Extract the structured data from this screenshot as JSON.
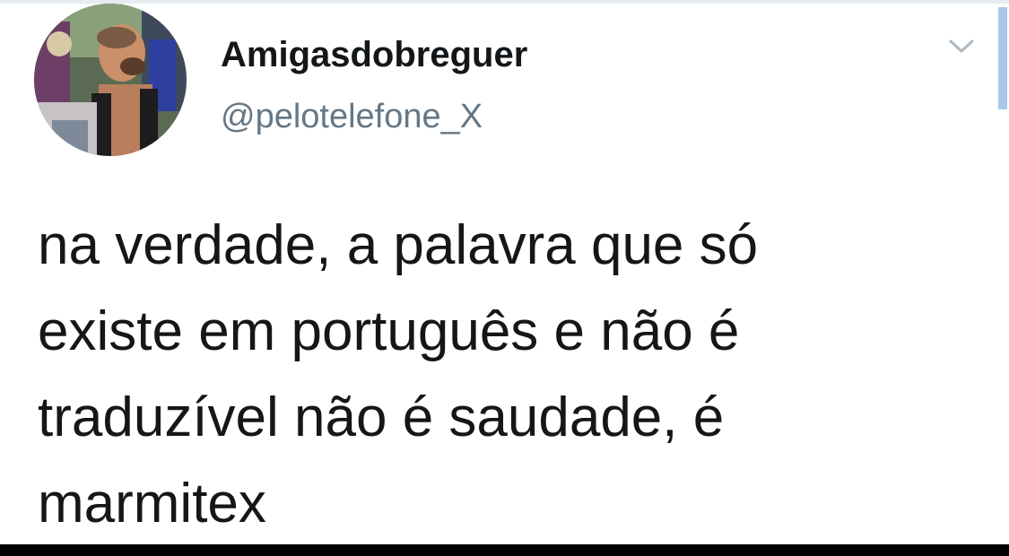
{
  "tweet": {
    "display_name": "Amigasdobreguer",
    "handle": "@pelotelefone_X",
    "text_lines": [
      "na verdade, a palavra que só",
      "existe em português e não é",
      "traduzível não é saudade, é",
      "marmitex"
    ]
  },
  "icons": {
    "menu": "chevron-down-icon",
    "avatar": "profile-photo"
  },
  "colors": {
    "text": "#14171a",
    "handle": "#657786",
    "caret": "#aab8c2",
    "accent": "#a9c8e8"
  }
}
